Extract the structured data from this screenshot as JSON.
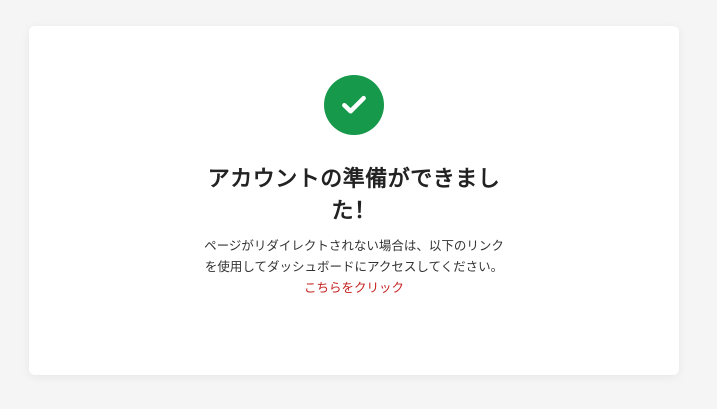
{
  "status": {
    "icon": "checkmark-circle-icon",
    "color": "#16994a"
  },
  "title": "アカウントの準備ができました！",
  "message": {
    "text": "ページがリダイレクトされない場合は、以下のリンクを使用してダッシュボードにアクセスしてください。",
    "link_text": "こちらをクリック",
    "link_color": "#c5221f"
  }
}
